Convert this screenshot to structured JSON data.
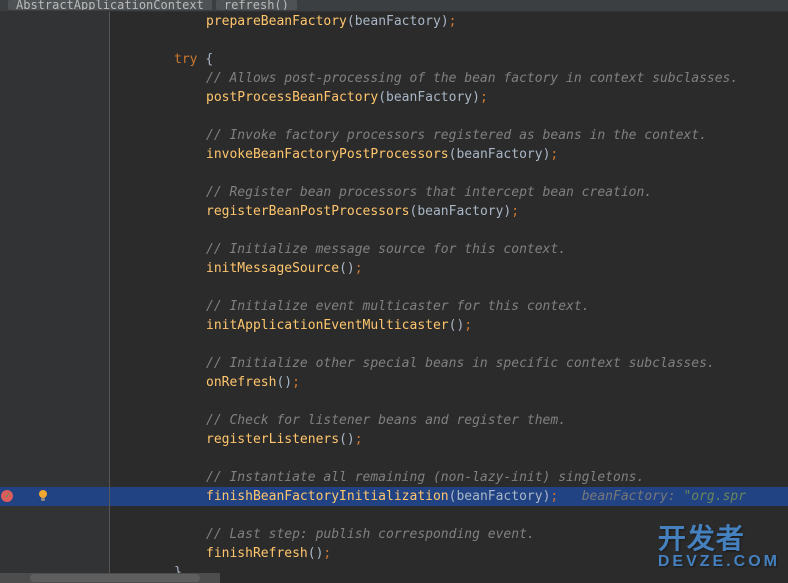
{
  "breadcrumb": {
    "class": "AbstractApplicationContext",
    "method": "refresh()"
  },
  "code": {
    "lines": [
      {
        "type": "call",
        "indent": 3,
        "method": "prepareBeanFactory",
        "args": "beanFactory"
      },
      {
        "type": "blank"
      },
      {
        "type": "try",
        "indent": 2
      },
      {
        "type": "comment",
        "indent": 3,
        "text": "// Allows post-processing of the bean factory in context subclasses."
      },
      {
        "type": "call",
        "indent": 3,
        "method": "postProcessBeanFactory",
        "args": "beanFactory"
      },
      {
        "type": "blank"
      },
      {
        "type": "comment",
        "indent": 3,
        "text": "// Invoke factory processors registered as beans in the context."
      },
      {
        "type": "call",
        "indent": 3,
        "method": "invokeBeanFactoryPostProcessors",
        "args": "beanFactory"
      },
      {
        "type": "blank"
      },
      {
        "type": "comment",
        "indent": 3,
        "text": "// Register bean processors that intercept bean creation."
      },
      {
        "type": "call",
        "indent": 3,
        "method": "registerBeanPostProcessors",
        "args": "beanFactory"
      },
      {
        "type": "blank"
      },
      {
        "type": "comment",
        "indent": 3,
        "text": "// Initialize message source for this context."
      },
      {
        "type": "call",
        "indent": 3,
        "method": "initMessageSource",
        "args": ""
      },
      {
        "type": "blank"
      },
      {
        "type": "comment",
        "indent": 3,
        "text": "// Initialize event multicaster for this context."
      },
      {
        "type": "call",
        "indent": 3,
        "method": "initApplicationEventMulticaster",
        "args": ""
      },
      {
        "type": "blank"
      },
      {
        "type": "comment",
        "indent": 3,
        "text": "// Initialize other special beans in specific context subclasses."
      },
      {
        "type": "call",
        "indent": 3,
        "method": "onRefresh",
        "args": ""
      },
      {
        "type": "blank"
      },
      {
        "type": "comment",
        "indent": 3,
        "text": "// Check for listener beans and register them."
      },
      {
        "type": "call",
        "indent": 3,
        "method": "registerListeners",
        "args": ""
      },
      {
        "type": "blank"
      },
      {
        "type": "comment",
        "indent": 3,
        "text": "// Instantiate all remaining (non-lazy-init) singletons."
      },
      {
        "type": "call-hl",
        "indent": 3,
        "method": "finishBeanFactoryInitialization",
        "args": "beanFactory",
        "inlayVar": "beanFactory: ",
        "inlayVal": "\"org.spr"
      },
      {
        "type": "blank"
      },
      {
        "type": "comment",
        "indent": 3,
        "text": "// Last step: publish corresponding event."
      },
      {
        "type": "call",
        "indent": 3,
        "method": "finishRefresh",
        "args": ""
      },
      {
        "type": "brace-close",
        "indent": 2
      }
    ]
  },
  "highlightLineIndex": 25,
  "watermark": {
    "main": "开发者",
    "sub": "DEVZE.COM"
  }
}
